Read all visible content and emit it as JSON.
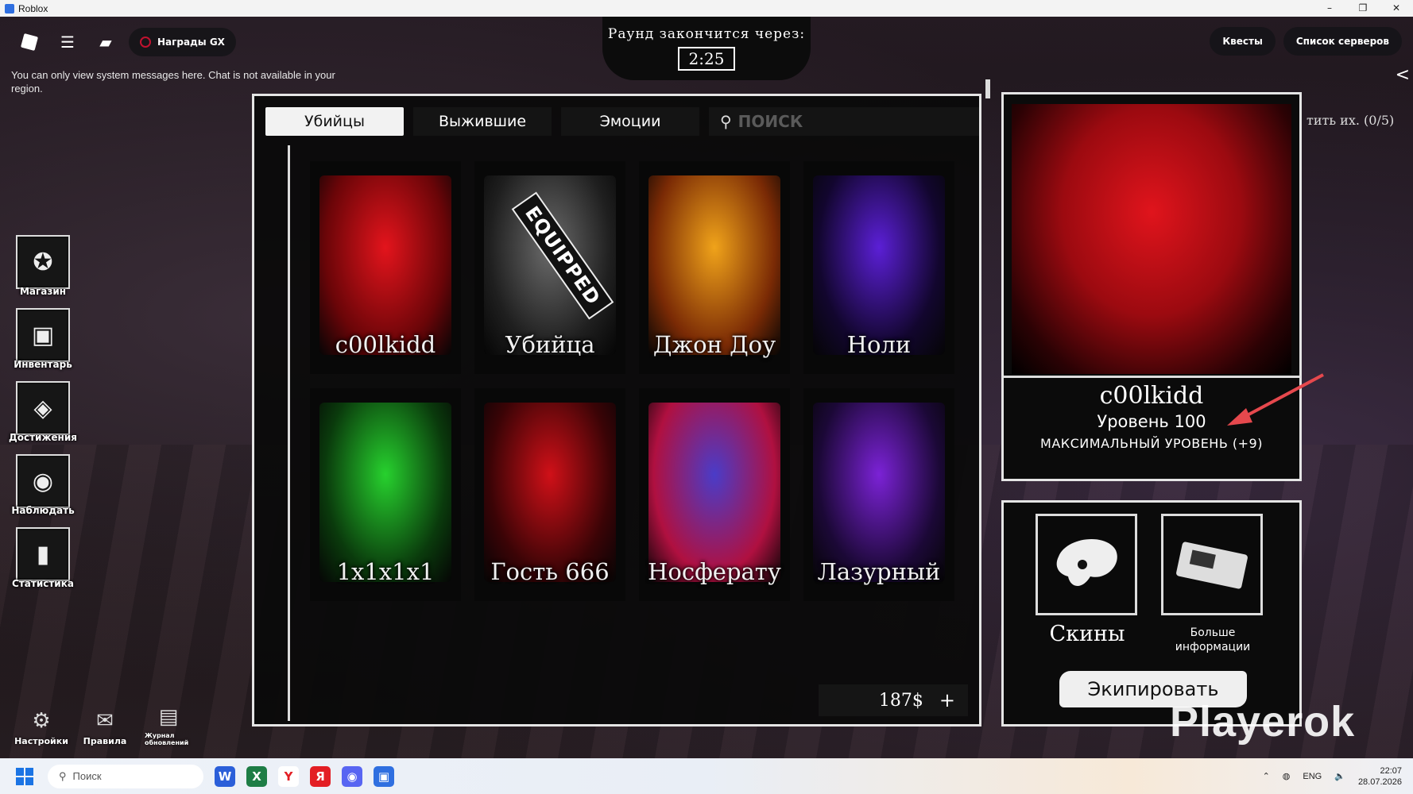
{
  "window": {
    "title": "Roblox",
    "controls": [
      "–",
      "❐",
      "✕"
    ]
  },
  "topbar": {
    "rewards_label": "Награды GX",
    "quests_label": "Квесты",
    "servers_label": "Список серверов"
  },
  "system_message": "You can only view system messages here. Chat is not available in your region.",
  "round": {
    "label": "Раунд закончится через:",
    "time": "2:25"
  },
  "dock": [
    {
      "label": "Магазин",
      "icon": "shop-icon"
    },
    {
      "label": "Инвентарь",
      "icon": "inventory-icon"
    },
    {
      "label": "Достижения",
      "icon": "achievements-icon"
    },
    {
      "label": "Наблюдать",
      "icon": "spectate-eye-icon"
    },
    {
      "label": "Статистика",
      "icon": "stats-icon"
    }
  ],
  "bottom_left": {
    "settings": "Настройки",
    "rules": "Правила",
    "changelog": "Журнал обновлений"
  },
  "tabs": [
    {
      "label": "Убийцы",
      "active": true
    },
    {
      "label": "Выжившие",
      "active": false
    },
    {
      "label": "Эмоции",
      "active": false
    }
  ],
  "search": {
    "placeholder": "ПОИСК",
    "value": ""
  },
  "killers": [
    {
      "name": "c00lkidd",
      "colors": [
        "#e3141c",
        "#6a0508"
      ],
      "equipped": false
    },
    {
      "name": "Убийца",
      "colors": [
        "#6b6b6b",
        "#1f1f1f"
      ],
      "equipped": true
    },
    {
      "name": "Джон Доу",
      "colors": [
        "#f0a31a",
        "#7a2a05"
      ],
      "equipped": false
    },
    {
      "name": "Ноли",
      "colors": [
        "#5b1fd6",
        "#12062e"
      ],
      "equipped": false
    },
    {
      "name": "1x1x1x1",
      "colors": [
        "#27d12e",
        "#0a3a0c"
      ],
      "equipped": false
    },
    {
      "name": "Гость 666",
      "colors": [
        "#d01018",
        "#3a0406"
      ],
      "equipped": false
    },
    {
      "name": "Носферату",
      "colors": [
        "#4a3cc8",
        "#b01040"
      ],
      "equipped": false
    },
    {
      "name": "Лазурный",
      "colors": [
        "#7b22d6",
        "#1b0836"
      ],
      "equipped": false
    }
  ],
  "equipped_badge": "EQUIPPED",
  "money": {
    "amount": "187$",
    "add": "+"
  },
  "preview": {
    "name": "c00lkidd",
    "level": "Уровень 100",
    "max_level": "МАКСИМАЛЬНЫЙ УРОВЕНЬ (+9)"
  },
  "top_hint": "тить их. (0/5)",
  "actions": {
    "skins": "Скины",
    "more_info_line1": "Больше",
    "more_info_line2": "информации",
    "equip": "Экипировать"
  },
  "watermark": "Playerok",
  "taskbar": {
    "search_placeholder": "Поиск",
    "language": "ENG",
    "time": "22:07",
    "date": "28.07.2026"
  }
}
